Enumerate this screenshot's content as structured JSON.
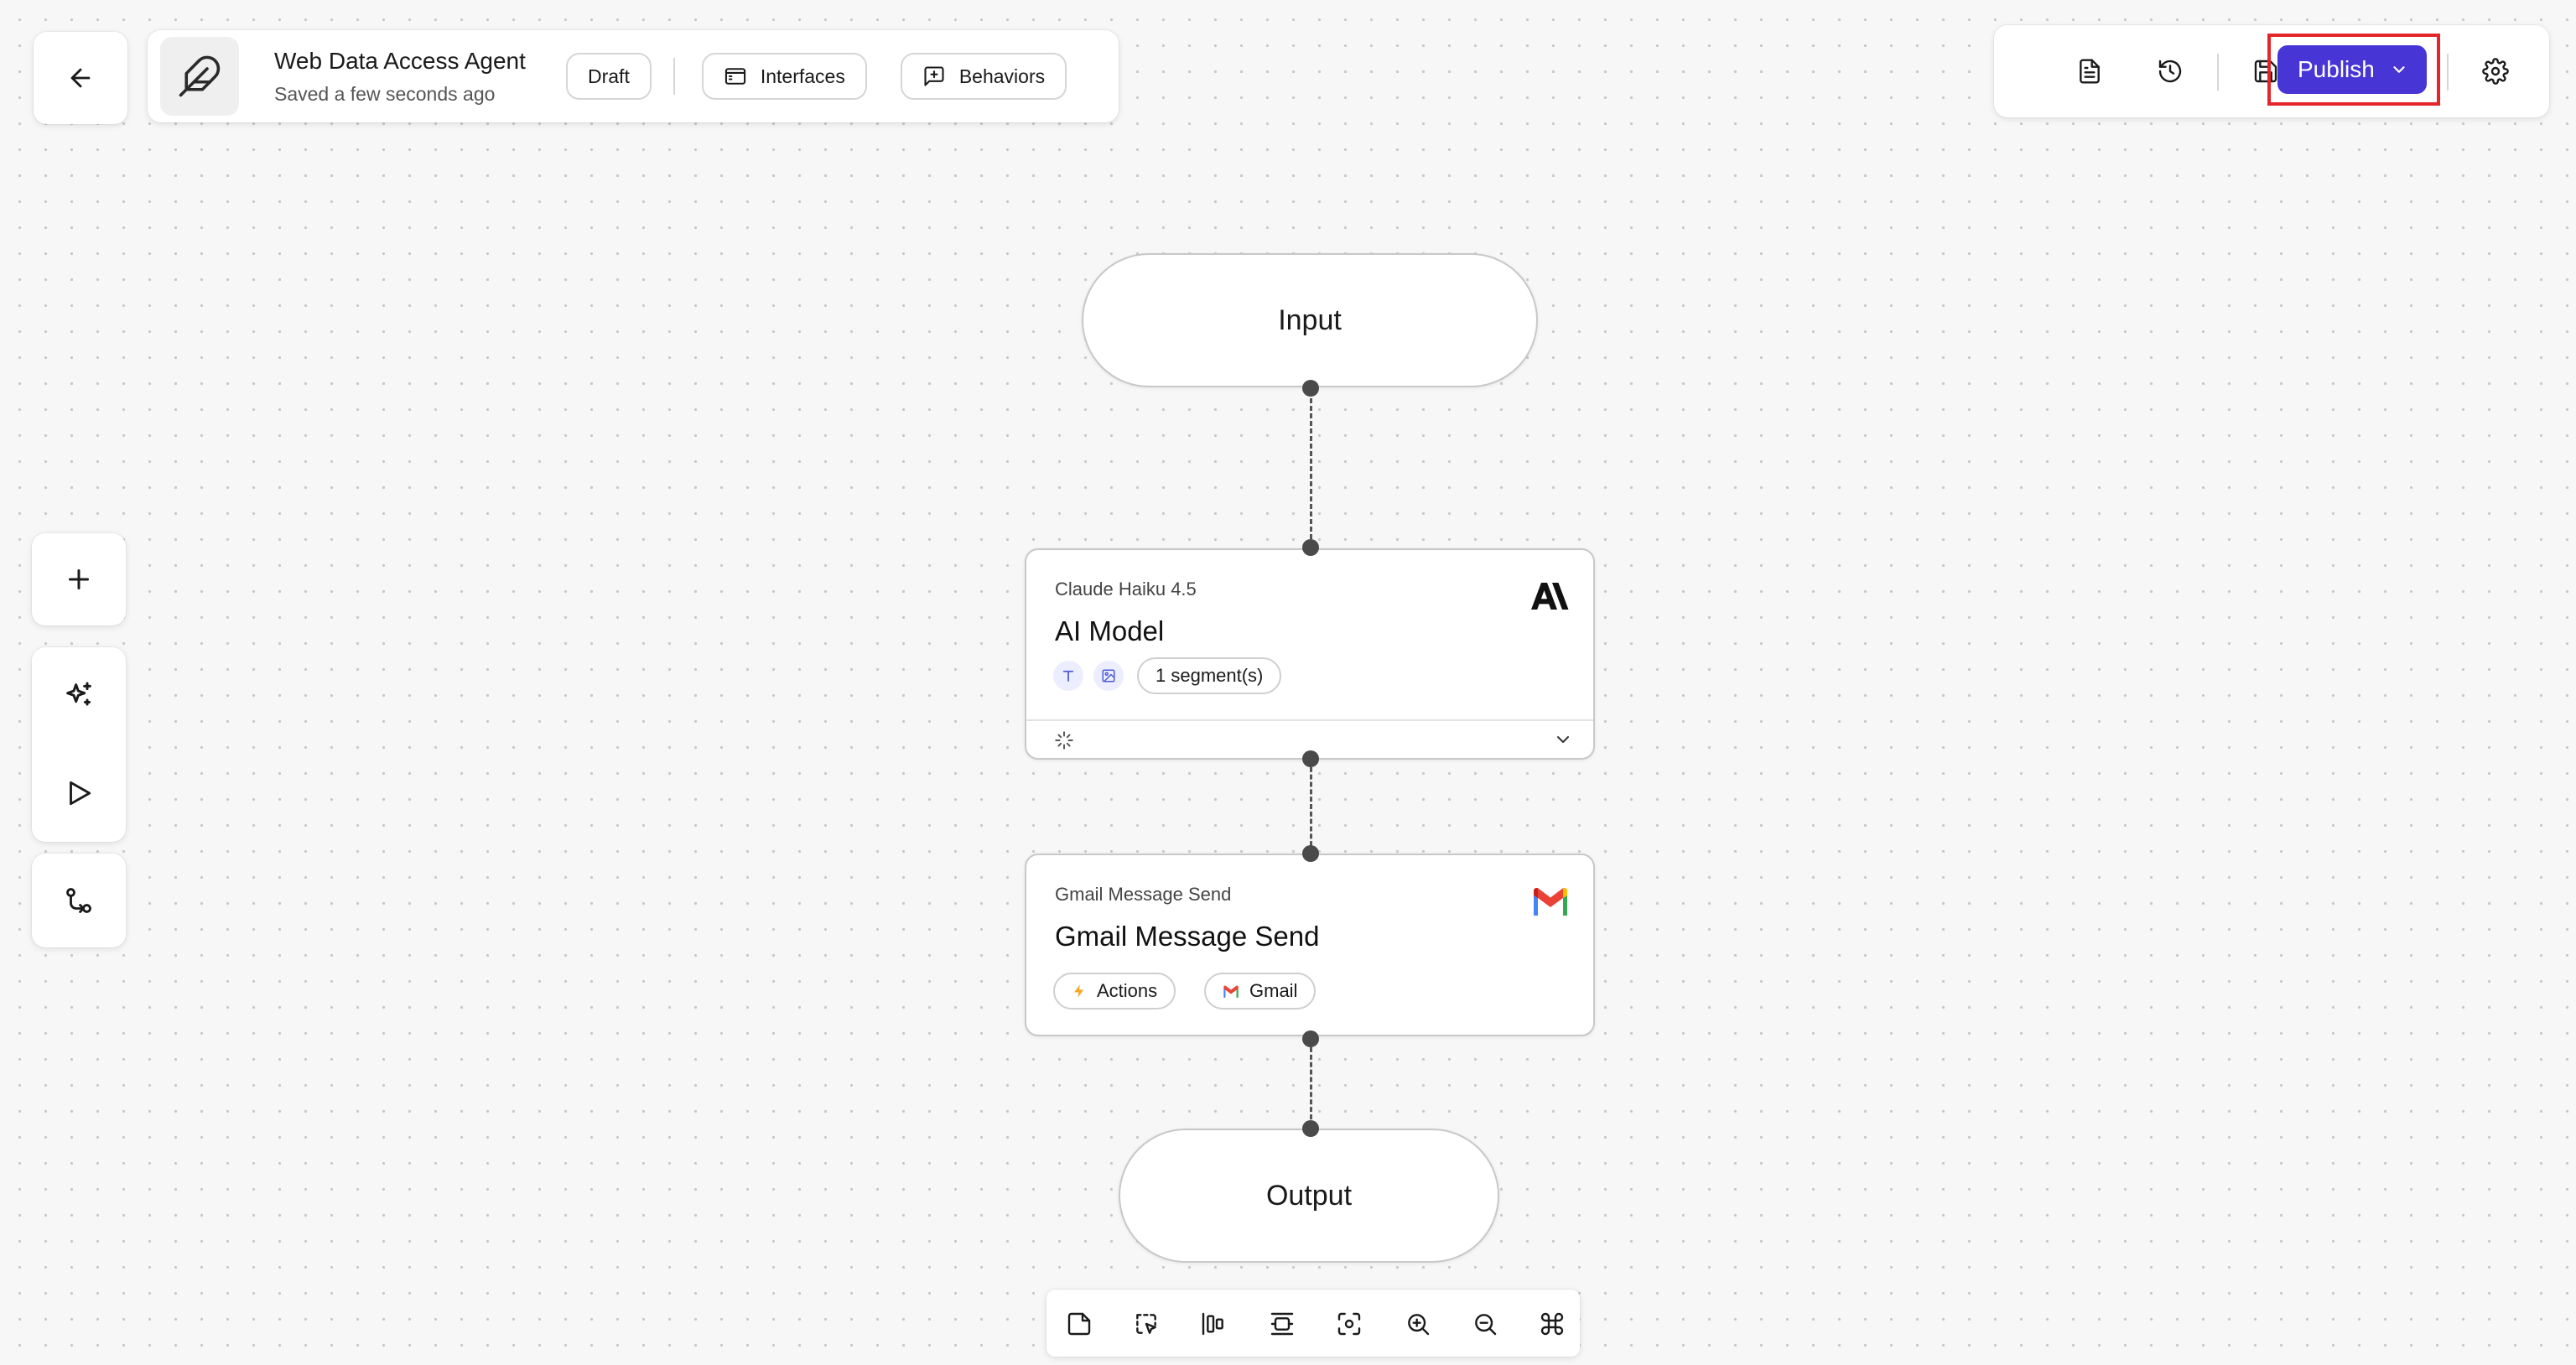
{
  "header": {
    "title": "Web Data Access Agent",
    "subtitle": "Saved a few seconds ago",
    "status_label": "Draft",
    "interfaces_label": "Interfaces",
    "behaviors_label": "Behaviors"
  },
  "toolbar": {
    "publish_label": "Publish",
    "icons": [
      "document-icon",
      "history-icon",
      "save-icon",
      "chevron-down-icon",
      "gear-icon"
    ]
  },
  "left_toolbar": {
    "icons": [
      "plus-icon",
      "sparkles-icon",
      "play-icon",
      "git-compare-icon"
    ]
  },
  "canvas": {
    "input_label": "Input",
    "output_label": "Output",
    "nodes": [
      {
        "subtitle": "Claude Haiku 4.5",
        "title": "AI Model",
        "logo": "anthropic-logo",
        "segments_label": "1 segment(s)"
      },
      {
        "subtitle": "Gmail Message Send",
        "title": "Gmail Message Send",
        "logo": "gmail-logo",
        "badges": [
          "Actions",
          "Gmail"
        ]
      }
    ]
  },
  "bottom_toolbar": {
    "icons": [
      "note-icon",
      "select-icon",
      "align-distribute-icon",
      "align-center-icon",
      "fit-view-icon",
      "zoom-in-icon",
      "zoom-out-icon",
      "command-icon"
    ]
  },
  "colors": {
    "publish_bg": "#4735d6",
    "highlight_border": "#e3262a",
    "canvas_bg": "#f7f7f7"
  }
}
